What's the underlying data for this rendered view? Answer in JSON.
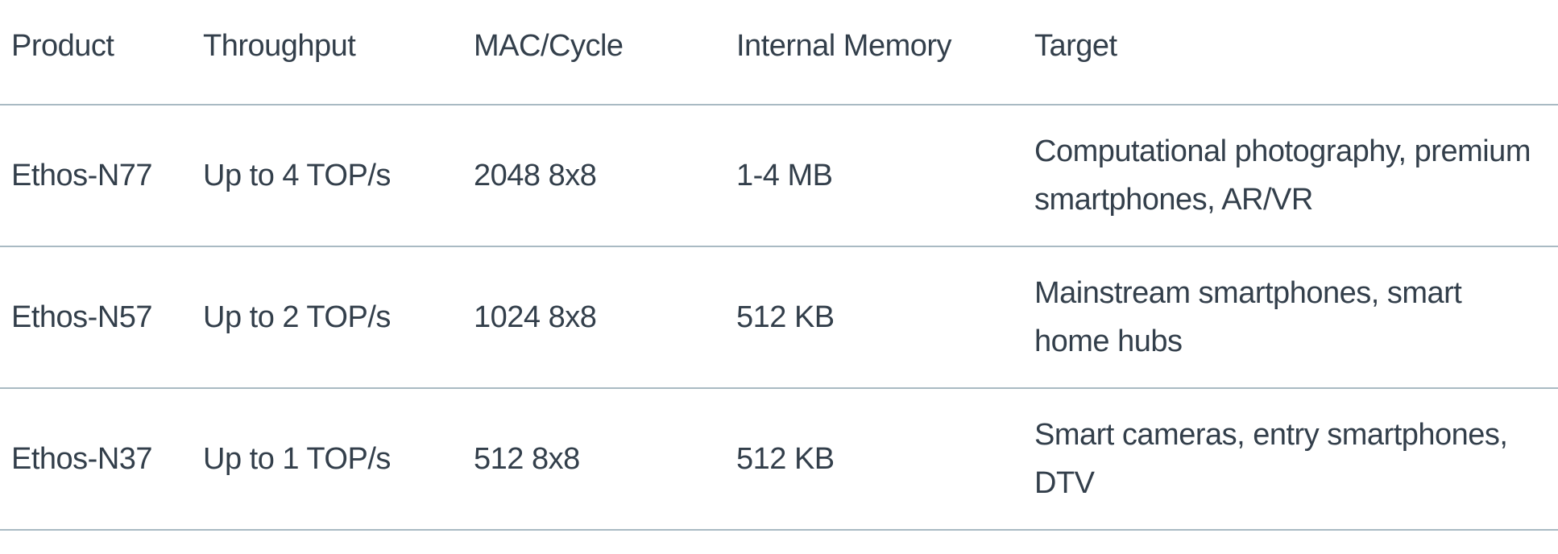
{
  "table": {
    "headers": [
      "Product",
      "Throughput",
      "MAC/Cycle",
      "Internal Memory",
      "Target"
    ],
    "rows": [
      [
        "Ethos-N77",
        "Up to 4 TOP/s",
        "2048 8x8",
        "1-4 MB",
        "Computational photography, premium smartphones, AR/VR"
      ],
      [
        "Ethos-N57",
        "Up to 2 TOP/s",
        "1024 8x8",
        "512 KB",
        "Mainstream smartphones, smart home hubs"
      ],
      [
        "Ethos-N37",
        "Up to 1 TOP/s",
        "512 8x8",
        "512 KB",
        "Smart cameras, entry smartphones, DTV"
      ]
    ]
  },
  "colors": {
    "text": "#333f4b",
    "border": "#a9bac3",
    "background": "#ffffff"
  }
}
